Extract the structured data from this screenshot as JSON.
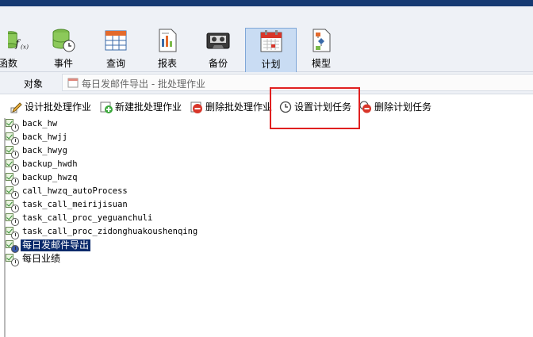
{
  "ribbon": {
    "tools": [
      {
        "id": "functions",
        "label": "函数",
        "icon": "function-icon"
      },
      {
        "id": "events",
        "label": "事件",
        "icon": "event-database-icon"
      },
      {
        "id": "query",
        "label": "查询",
        "icon": "query-table-icon"
      },
      {
        "id": "reports",
        "label": "报表",
        "icon": "report-icon"
      },
      {
        "id": "backup",
        "label": "备份",
        "icon": "backup-cassette-icon"
      },
      {
        "id": "schedule",
        "label": "计划",
        "icon": "calendar-icon",
        "active": true
      },
      {
        "id": "model",
        "label": "模型",
        "icon": "model-icon"
      }
    ]
  },
  "object_bar": {
    "label": "对象",
    "tab_text": "每日发邮件导出 - 批处理作业"
  },
  "actions": {
    "design": "设计批处理作业",
    "new": "新建批处理作业",
    "delete": "删除批处理作业",
    "set_schedule": "设置计划任务",
    "delete_schedule": "删除计划任务"
  },
  "tree": {
    "items": [
      {
        "name": "back_hw"
      },
      {
        "name": "back_hwjj"
      },
      {
        "name": "back_hwyg"
      },
      {
        "name": "backup_hwdh"
      },
      {
        "name": "backup_hwzq"
      },
      {
        "name": "call_hwzq_autoProcess"
      },
      {
        "name": "task_call_meirijisuan"
      },
      {
        "name": "task_call_proc_yeguanchuli"
      },
      {
        "name": "task_call_proc_zidonghuakoushenqing"
      },
      {
        "name": "每日发邮件导出",
        "selected": true
      },
      {
        "name": "每日业绩"
      }
    ]
  },
  "colors": {
    "titlebar": "#163a72",
    "selection": "#0a2a6b",
    "highlight_box": "#e02020"
  }
}
